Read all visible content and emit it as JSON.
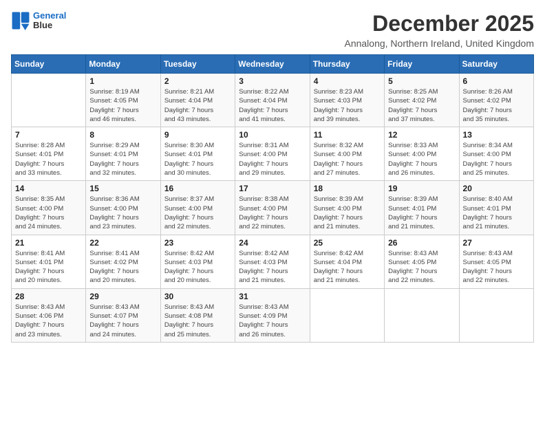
{
  "header": {
    "logo_line1": "General",
    "logo_line2": "Blue",
    "month_title": "December 2025",
    "subtitle": "Annalong, Northern Ireland, United Kingdom"
  },
  "days_of_week": [
    "Sunday",
    "Monday",
    "Tuesday",
    "Wednesday",
    "Thursday",
    "Friday",
    "Saturday"
  ],
  "weeks": [
    [
      {
        "day": "",
        "info": ""
      },
      {
        "day": "1",
        "info": "Sunrise: 8:19 AM\nSunset: 4:05 PM\nDaylight: 7 hours\nand 46 minutes."
      },
      {
        "day": "2",
        "info": "Sunrise: 8:21 AM\nSunset: 4:04 PM\nDaylight: 7 hours\nand 43 minutes."
      },
      {
        "day": "3",
        "info": "Sunrise: 8:22 AM\nSunset: 4:04 PM\nDaylight: 7 hours\nand 41 minutes."
      },
      {
        "day": "4",
        "info": "Sunrise: 8:23 AM\nSunset: 4:03 PM\nDaylight: 7 hours\nand 39 minutes."
      },
      {
        "day": "5",
        "info": "Sunrise: 8:25 AM\nSunset: 4:02 PM\nDaylight: 7 hours\nand 37 minutes."
      },
      {
        "day": "6",
        "info": "Sunrise: 8:26 AM\nSunset: 4:02 PM\nDaylight: 7 hours\nand 35 minutes."
      }
    ],
    [
      {
        "day": "7",
        "info": "Sunrise: 8:28 AM\nSunset: 4:01 PM\nDaylight: 7 hours\nand 33 minutes."
      },
      {
        "day": "8",
        "info": "Sunrise: 8:29 AM\nSunset: 4:01 PM\nDaylight: 7 hours\nand 32 minutes."
      },
      {
        "day": "9",
        "info": "Sunrise: 8:30 AM\nSunset: 4:01 PM\nDaylight: 7 hours\nand 30 minutes."
      },
      {
        "day": "10",
        "info": "Sunrise: 8:31 AM\nSunset: 4:00 PM\nDaylight: 7 hours\nand 29 minutes."
      },
      {
        "day": "11",
        "info": "Sunrise: 8:32 AM\nSunset: 4:00 PM\nDaylight: 7 hours\nand 27 minutes."
      },
      {
        "day": "12",
        "info": "Sunrise: 8:33 AM\nSunset: 4:00 PM\nDaylight: 7 hours\nand 26 minutes."
      },
      {
        "day": "13",
        "info": "Sunrise: 8:34 AM\nSunset: 4:00 PM\nDaylight: 7 hours\nand 25 minutes."
      }
    ],
    [
      {
        "day": "14",
        "info": "Sunrise: 8:35 AM\nSunset: 4:00 PM\nDaylight: 7 hours\nand 24 minutes."
      },
      {
        "day": "15",
        "info": "Sunrise: 8:36 AM\nSunset: 4:00 PM\nDaylight: 7 hours\nand 23 minutes."
      },
      {
        "day": "16",
        "info": "Sunrise: 8:37 AM\nSunset: 4:00 PM\nDaylight: 7 hours\nand 22 minutes."
      },
      {
        "day": "17",
        "info": "Sunrise: 8:38 AM\nSunset: 4:00 PM\nDaylight: 7 hours\nand 22 minutes."
      },
      {
        "day": "18",
        "info": "Sunrise: 8:39 AM\nSunset: 4:00 PM\nDaylight: 7 hours\nand 21 minutes."
      },
      {
        "day": "19",
        "info": "Sunrise: 8:39 AM\nSunset: 4:01 PM\nDaylight: 7 hours\nand 21 minutes."
      },
      {
        "day": "20",
        "info": "Sunrise: 8:40 AM\nSunset: 4:01 PM\nDaylight: 7 hours\nand 21 minutes."
      }
    ],
    [
      {
        "day": "21",
        "info": "Sunrise: 8:41 AM\nSunset: 4:01 PM\nDaylight: 7 hours\nand 20 minutes."
      },
      {
        "day": "22",
        "info": "Sunrise: 8:41 AM\nSunset: 4:02 PM\nDaylight: 7 hours\nand 20 minutes."
      },
      {
        "day": "23",
        "info": "Sunrise: 8:42 AM\nSunset: 4:03 PM\nDaylight: 7 hours\nand 20 minutes."
      },
      {
        "day": "24",
        "info": "Sunrise: 8:42 AM\nSunset: 4:03 PM\nDaylight: 7 hours\nand 21 minutes."
      },
      {
        "day": "25",
        "info": "Sunrise: 8:42 AM\nSunset: 4:04 PM\nDaylight: 7 hours\nand 21 minutes."
      },
      {
        "day": "26",
        "info": "Sunrise: 8:43 AM\nSunset: 4:05 PM\nDaylight: 7 hours\nand 22 minutes."
      },
      {
        "day": "27",
        "info": "Sunrise: 8:43 AM\nSunset: 4:05 PM\nDaylight: 7 hours\nand 22 minutes."
      }
    ],
    [
      {
        "day": "28",
        "info": "Sunrise: 8:43 AM\nSunset: 4:06 PM\nDaylight: 7 hours\nand 23 minutes."
      },
      {
        "day": "29",
        "info": "Sunrise: 8:43 AM\nSunset: 4:07 PM\nDaylight: 7 hours\nand 24 minutes."
      },
      {
        "day": "30",
        "info": "Sunrise: 8:43 AM\nSunset: 4:08 PM\nDaylight: 7 hours\nand 25 minutes."
      },
      {
        "day": "31",
        "info": "Sunrise: 8:43 AM\nSunset: 4:09 PM\nDaylight: 7 hours\nand 26 minutes."
      },
      {
        "day": "",
        "info": ""
      },
      {
        "day": "",
        "info": ""
      },
      {
        "day": "",
        "info": ""
      }
    ]
  ]
}
